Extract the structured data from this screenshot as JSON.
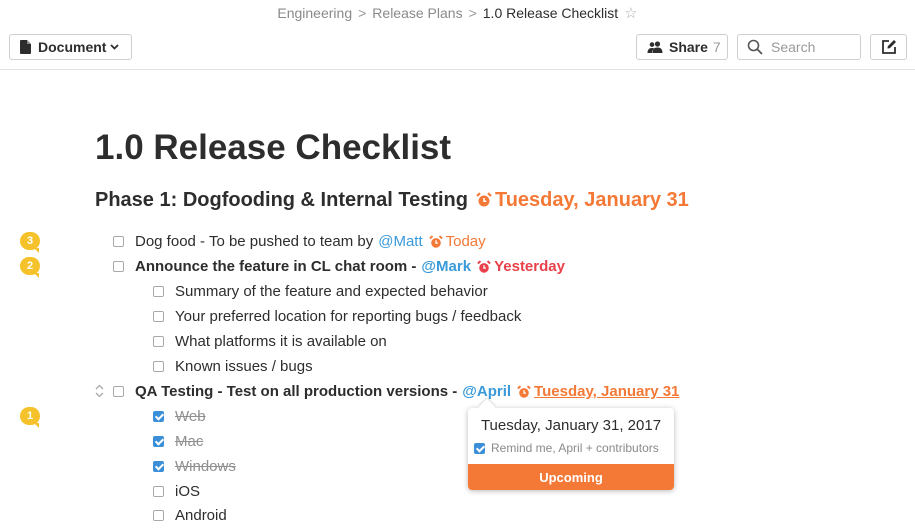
{
  "breadcrumb": {
    "items": [
      "Engineering",
      "Release Plans"
    ],
    "current": "1.0 Release Checklist",
    "separator": ">"
  },
  "toolbar": {
    "document_label": "Document",
    "share_label": "Share",
    "share_count": "7",
    "search_placeholder": "Search"
  },
  "doc": {
    "title": "1.0 Release Checklist",
    "phase": {
      "label": "Phase 1: Dogfooding & Internal Testing",
      "due": "Tuesday, January 31"
    },
    "items": [
      {
        "text": "Dog food - To be pushed to team by",
        "mention": "@Matt",
        "due": "Today",
        "badge": "3"
      },
      {
        "text": "Announce the feature in CL chat room -",
        "mention": "@Mark",
        "due": "Yesterday",
        "badge": "2"
      },
      {
        "text": "Summary of the feature and expected behavior"
      },
      {
        "text": "Your preferred location for reporting bugs / feedback"
      },
      {
        "text": "What platforms it is available on"
      },
      {
        "text": "Known issues / bugs"
      },
      {
        "text": "QA Testing - Test on all production versions -",
        "mention": "@April",
        "due": "Tuesday, January 31"
      },
      {
        "text": "Web",
        "checked": true,
        "badge": "1"
      },
      {
        "text": "Mac",
        "checked": true
      },
      {
        "text": "Windows",
        "checked": true
      },
      {
        "text": "iOS"
      },
      {
        "text": "Android"
      }
    ]
  },
  "popover": {
    "date": "Tuesday, January 31, 2017",
    "remind": "Remind me, April + contributors",
    "button": "Upcoming"
  },
  "colors": {
    "accent_orange": "#f47936",
    "overdue_red": "#e8414a",
    "mention_blue": "#3a9ad9",
    "checkbox_blue": "#3b8fd9",
    "badge_yellow": "#f5c22b"
  },
  "icons": [
    "star-icon",
    "document-icon",
    "chevron-down-icon",
    "people-icon",
    "search-icon",
    "edit-icon",
    "alarm-clock-icon",
    "reorder-icon",
    "comment-badge-icon"
  ]
}
